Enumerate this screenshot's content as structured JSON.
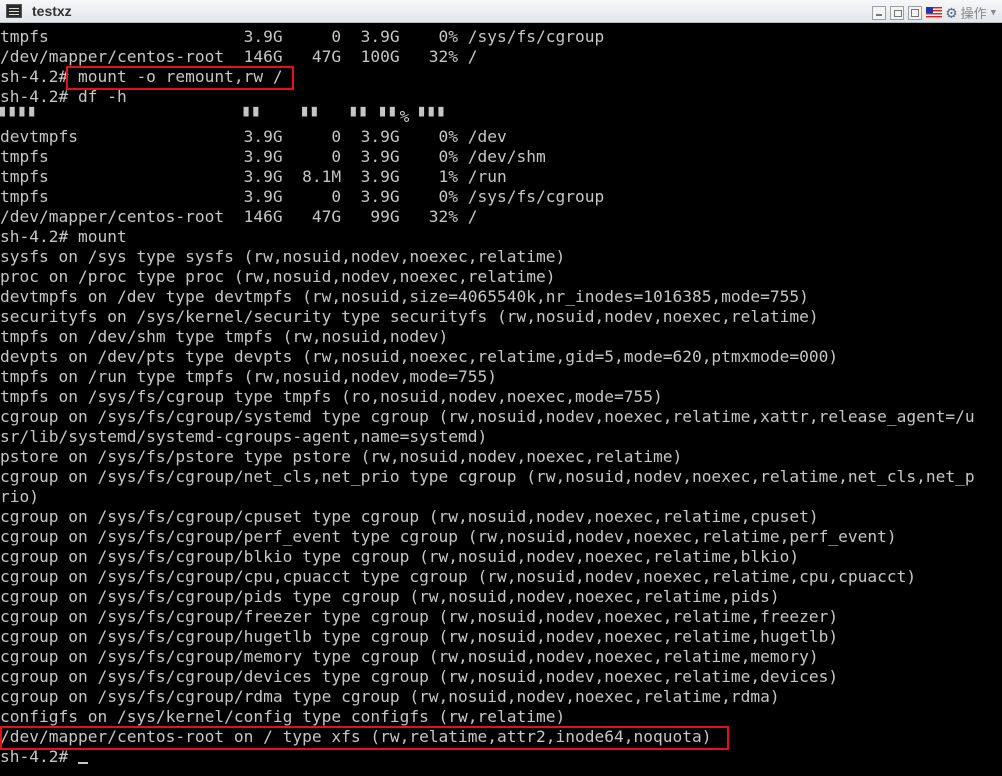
{
  "window": {
    "title": "testxz",
    "ops_label": "操作"
  },
  "icons": [
    "terminal-icon",
    "minimize-icon",
    "restore-icon",
    "maximize-icon",
    "keyboard-layout-flag-icon",
    "gear-icon",
    "chevron-down-icon"
  ],
  "terminal": {
    "lines": [
      "tmpfs                    3.9G     0  3.9G    0% /sys/fs/cgroup",
      "/dev/mapper/centos-root  146G   47G  100G   32% /",
      "sh-4.2# mount -o remount,rw /",
      "sh-4.2# df -h",
      "▘▘▘▘                     ▘▘    ▘▘   ▘▘ ▘▘% ▘▘▘",
      "devtmpfs                 3.9G     0  3.9G    0% /dev",
      "tmpfs                    3.9G     0  3.9G    0% /dev/shm",
      "tmpfs                    3.9G  8.1M  3.9G    1% /run",
      "tmpfs                    3.9G     0  3.9G    0% /sys/fs/cgroup",
      "/dev/mapper/centos-root  146G   47G   99G   32% /",
      "sh-4.2# mount",
      "sysfs on /sys type sysfs (rw,nosuid,nodev,noexec,relatime)",
      "proc on /proc type proc (rw,nosuid,nodev,noexec,relatime)",
      "devtmpfs on /dev type devtmpfs (rw,nosuid,size=4065540k,nr_inodes=1016385,mode=755)",
      "securityfs on /sys/kernel/security type securityfs (rw,nosuid,nodev,noexec,relatime)",
      "tmpfs on /dev/shm type tmpfs (rw,nosuid,nodev)",
      "devpts on /dev/pts type devpts (rw,nosuid,noexec,relatime,gid=5,mode=620,ptmxmode=000)",
      "tmpfs on /run type tmpfs (rw,nosuid,nodev,mode=755)",
      "tmpfs on /sys/fs/cgroup type tmpfs (ro,nosuid,nodev,noexec,mode=755)",
      "cgroup on /sys/fs/cgroup/systemd type cgroup (rw,nosuid,nodev,noexec,relatime,xattr,release_agent=/u",
      "sr/lib/systemd/systemd-cgroups-agent,name=systemd)",
      "pstore on /sys/fs/pstore type pstore (rw,nosuid,nodev,noexec,relatime)",
      "cgroup on /sys/fs/cgroup/net_cls,net_prio type cgroup (rw,nosuid,nodev,noexec,relatime,net_cls,net_p",
      "rio)",
      "cgroup on /sys/fs/cgroup/cpuset type cgroup (rw,nosuid,nodev,noexec,relatime,cpuset)",
      "cgroup on /sys/fs/cgroup/perf_event type cgroup (rw,nosuid,nodev,noexec,relatime,perf_event)",
      "cgroup on /sys/fs/cgroup/blkio type cgroup (rw,nosuid,nodev,noexec,relatime,blkio)",
      "cgroup on /sys/fs/cgroup/cpu,cpuacct type cgroup (rw,nosuid,nodev,noexec,relatime,cpu,cpuacct)",
      "cgroup on /sys/fs/cgroup/pids type cgroup (rw,nosuid,nodev,noexec,relatime,pids)",
      "cgroup on /sys/fs/cgroup/freezer type cgroup (rw,nosuid,nodev,noexec,relatime,freezer)",
      "cgroup on /sys/fs/cgroup/hugetlb type cgroup (rw,nosuid,nodev,noexec,relatime,hugetlb)",
      "cgroup on /sys/fs/cgroup/memory type cgroup (rw,nosuid,nodev,noexec,relatime,memory)",
      "cgroup on /sys/fs/cgroup/devices type cgroup (rw,nosuid,nodev,noexec,relatime,devices)",
      "cgroup on /sys/fs/cgroup/rdma type cgroup (rw,nosuid,nodev,noexec,relatime,rdma)",
      "configfs on /sys/kernel/config type configfs (rw,relatime)",
      "/dev/mapper/centos-root on / type xfs (rw,relatime,attr2,inode64,noquota)",
      "sh-4.2# "
    ]
  },
  "colors": {
    "terminal_bg": "#000000",
    "terminal_fg": "#c6c6c6",
    "highlight": "#e2101a"
  }
}
